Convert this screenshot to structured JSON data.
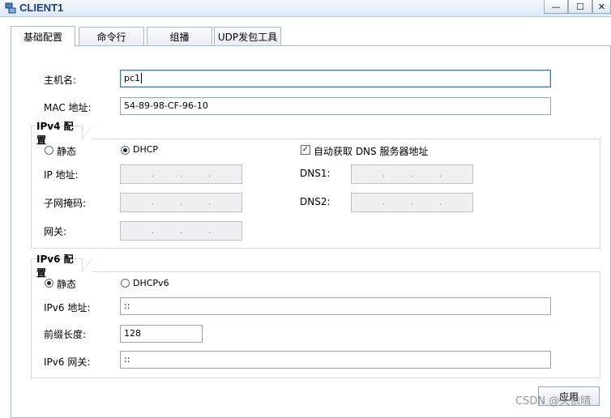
{
  "window": {
    "title": "CLIENT1",
    "minimize_glyph": "—",
    "maximize_glyph": "☐",
    "close_glyph": "✕"
  },
  "tabs": [
    {
      "label": "基础配置",
      "active": true
    },
    {
      "label": "命令行",
      "active": false
    },
    {
      "label": "组播",
      "active": false
    },
    {
      "label": "UDP发包工具",
      "active": false
    }
  ],
  "basic": {
    "hostname_label": "主机名:",
    "hostname_value": "pc1",
    "mac_label": "MAC 地址:",
    "mac_value": "54-89-98-CF-96-10"
  },
  "ipv4": {
    "group_title": "IPv4 配置",
    "static_label": "静态",
    "dhcp_label": "DHCP",
    "selected": "DHCP",
    "auto_dns_label": "自动获取 DNS 服务器地址",
    "auto_dns_checked": true,
    "ip_label": "IP 地址:",
    "mask_label": "子网掩码:",
    "gateway_label": "网关:",
    "dns1_label": "DNS1:",
    "dns2_label": "DNS2:",
    "ip_sep": "."
  },
  "ipv6": {
    "group_title": "IPv6 配置",
    "static_label": "静态",
    "dhcpv6_label": "DHCPv6",
    "selected": "静态",
    "addr_label": "IPv6 地址:",
    "addr_value": "::",
    "prefix_label": "前缀长度:",
    "prefix_value": "128",
    "gateway_label": "IPv6 网关:",
    "gateway_value": "::"
  },
  "apply_label": "应用",
  "watermark": "CSDN @天依晴",
  "colors": {
    "title_text": "#1b3f78",
    "focus_border": "#3d7bad"
  }
}
